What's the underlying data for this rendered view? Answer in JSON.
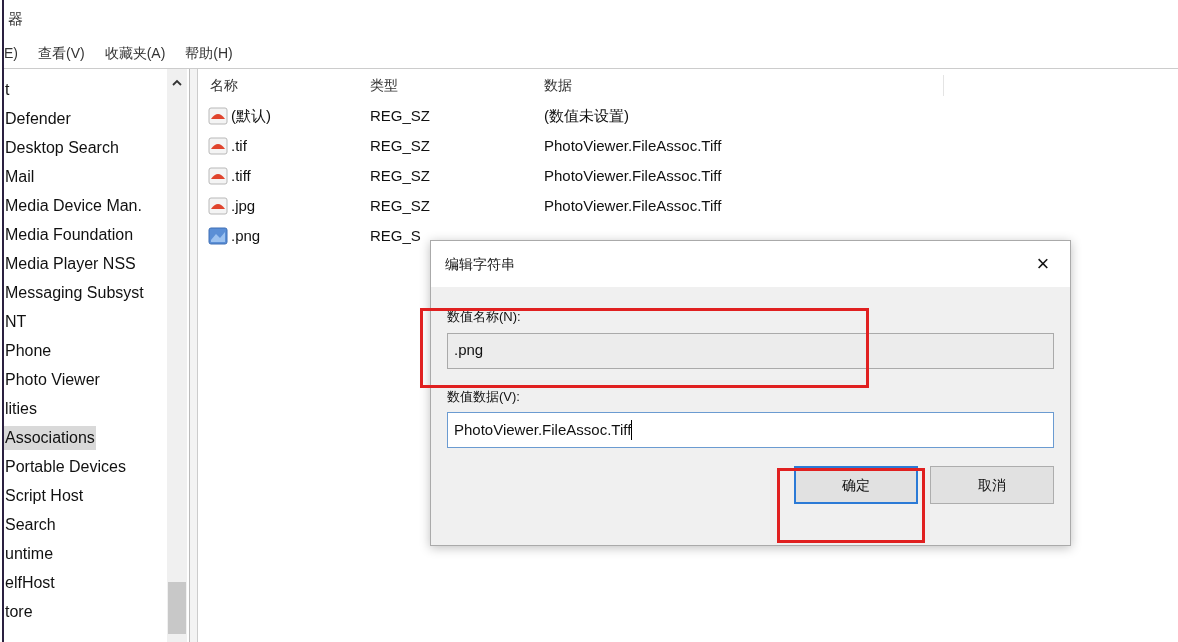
{
  "window": {
    "title": "器"
  },
  "menu": [
    "E)",
    "查看(V)",
    "收藏夹(A)",
    "帮助(H)"
  ],
  "tree": {
    "items": [
      {
        "label": "t",
        "selected": false
      },
      {
        "label": "Defender",
        "selected": false
      },
      {
        "label": "Desktop Search",
        "selected": false
      },
      {
        "label": "Mail",
        "selected": false
      },
      {
        "label": "Media Device Man.",
        "selected": false
      },
      {
        "label": "Media Foundation",
        "selected": false
      },
      {
        "label": "Media Player NSS",
        "selected": false
      },
      {
        "label": "Messaging Subsyst",
        "selected": false
      },
      {
        "label": "NT",
        "selected": false
      },
      {
        "label": "Phone",
        "selected": false
      },
      {
        "label": "Photo Viewer",
        "selected": false
      },
      {
        "label": "lities",
        "selected": false
      },
      {
        "label": "Associations",
        "selected": true
      },
      {
        "label": "Portable Devices",
        "selected": false
      },
      {
        "label": "Script Host",
        "selected": false
      },
      {
        "label": "Search",
        "selected": false
      },
      {
        "label": "untime",
        "selected": false
      },
      {
        "label": "elfHost",
        "selected": false
      },
      {
        "label": "tore",
        "selected": false
      }
    ]
  },
  "values": {
    "columns": [
      "名称",
      "类型",
      "数据"
    ],
    "rows": [
      {
        "kind": "string",
        "name": "(默认)",
        "type": "REG_SZ",
        "data": "(数值未设置)"
      },
      {
        "kind": "string",
        "name": ".tif",
        "type": "REG_SZ",
        "data": "PhotoViewer.FileAssoc.Tiff"
      },
      {
        "kind": "string",
        "name": ".tiff",
        "type": "REG_SZ",
        "data": "PhotoViewer.FileAssoc.Tiff"
      },
      {
        "kind": "string",
        "name": ".jpg",
        "type": "REG_SZ",
        "data": "PhotoViewer.FileAssoc.Tiff"
      },
      {
        "kind": "binary",
        "name": ".png",
        "type": "REG_S"
      }
    ]
  },
  "dialog": {
    "title": "编辑字符串",
    "close": "×",
    "name_label": "数值名称(N):",
    "name_value": ".png",
    "data_label": "数值数据(V):",
    "data_value": "PhotoViewer.FileAssoc.Tiff",
    "buttons": [
      {
        "label": "确定",
        "focused": true
      },
      {
        "label": "取消",
        "focused": false
      }
    ]
  }
}
